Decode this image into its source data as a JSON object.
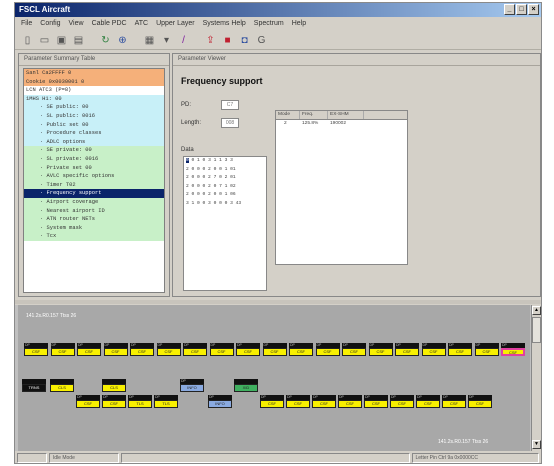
{
  "app": {
    "title": "FSCL Aircraft"
  },
  "menu": [
    "File",
    "Config",
    "View",
    "Cable PDC",
    "ATC",
    "Upper Layer",
    "Systems Help",
    "Spectrum",
    "Help"
  ],
  "toolbar_icons": [
    "new-icon",
    "open-icon",
    "save-icon",
    "print-icon",
    "refresh-icon",
    "zoom-icon",
    "grid-icon",
    "filter-icon",
    "pen-icon",
    "upload-icon",
    "stop-icon",
    "camera-icon",
    "settings-icon"
  ],
  "tree": {
    "header": "Parameter Summary Table",
    "items": [
      {
        "text": "Sanl    Ca2FFFF 0",
        "level": 0,
        "bg": "#f5b07a"
      },
      {
        "text": "Cookie   0x0030001 0",
        "level": 0,
        "bg": "#f5b07a"
      },
      {
        "text": "LCN      ATC3 (P=8)",
        "level": 0,
        "bg": "#ffffff"
      },
      {
        "text": "1MHS     H1: 00",
        "level": 0,
        "bg": "#c8f0f8"
      },
      {
        "text": "SE public: 00",
        "level": 1,
        "bg": "#c8f0f8"
      },
      {
        "text": "SL public: 0016",
        "level": 1,
        "bg": "#c8f0f8"
      },
      {
        "text": "Public set 00",
        "level": 1,
        "bg": "#c8f0f8"
      },
      {
        "text": "Procedure classes",
        "level": 1,
        "bg": "#c8f0f8"
      },
      {
        "text": "ADLC options",
        "level": 1,
        "bg": "#c8f0f8"
      },
      {
        "text": "SE private: 00",
        "level": 1,
        "bg": "#c8f0c8"
      },
      {
        "text": "SL private: 0016",
        "level": 1,
        "bg": "#c8f0c8"
      },
      {
        "text": "Private set 00",
        "level": 1,
        "bg": "#c8f0c8"
      },
      {
        "text": "AVLC specific options",
        "level": 1,
        "bg": "#c8f0c8"
      },
      {
        "text": "Timer T02",
        "level": 1,
        "bg": "#c8f0c8"
      },
      {
        "text": "Frequency support",
        "level": 1,
        "bg": "#0a246a",
        "selected": true
      },
      {
        "text": "Airport coverage",
        "level": 1,
        "bg": "#c8f0c8"
      },
      {
        "text": "Nearest airport ID",
        "level": 1,
        "bg": "#c8f0c8"
      },
      {
        "text": "ATN router NETs",
        "level": 1,
        "bg": "#c8f0c8"
      },
      {
        "text": "System mask",
        "level": 1,
        "bg": "#c8f0c8"
      },
      {
        "text": "Tcx",
        "level": 1,
        "bg": "#c8f0c8"
      }
    ]
  },
  "param": {
    "header": "Parameter Viewer",
    "title": "Frequency support",
    "pd_label": "PD:",
    "pd_value": "C7",
    "length_label": "Length:",
    "length_value": "008",
    "data_label": "Data",
    "data_rows": [
      "0 0 1 0 3 1 1 3 3",
      "2 0 0 0 2 0 0 1 01",
      "2 0 0 0 2 7 0 2 01",
      "2 0 0 0 2 0 7 1 02",
      "2 0 0 0 2 0 0 1 06",
      "3 1 0 0 3 0 0 0 3 43"
    ],
    "data_selected": "0",
    "table_headers": [
      "Mode",
      "Freq.",
      "EX-SHM"
    ],
    "table_rows": [
      [
        "2",
        "125.8%",
        "190002"
      ]
    ]
  },
  "timeline": {
    "info_top": "141.2s.R0.157  Ttss 26",
    "info_bottom": "141.2s.R0.157  Ttss 26",
    "row1": [
      {
        "hd": "DP",
        "label": "CSF",
        "style": ""
      },
      {
        "hd": "DP",
        "label": "CSF",
        "style": ""
      },
      {
        "hd": "DP",
        "label": "CSF",
        "style": ""
      },
      {
        "hd": "DP",
        "label": "CSF",
        "style": ""
      },
      {
        "hd": "DP",
        "label": "CSF",
        "style": ""
      },
      {
        "hd": "DP",
        "label": "CSF",
        "style": ""
      },
      {
        "hd": "DP",
        "label": "CSF",
        "style": ""
      },
      {
        "hd": "DP",
        "label": "CSF",
        "style": ""
      },
      {
        "hd": "DP",
        "label": "CSF",
        "style": ""
      },
      {
        "hd": "DP",
        "label": "CSF",
        "style": ""
      },
      {
        "hd": "DP",
        "label": "CSF",
        "style": ""
      },
      {
        "hd": "DP",
        "label": "CSF",
        "style": ""
      },
      {
        "hd": "DP",
        "label": "CSF",
        "style": ""
      },
      {
        "hd": "DP",
        "label": "CSF",
        "style": ""
      },
      {
        "hd": "DP",
        "label": "CSF",
        "style": ""
      },
      {
        "hd": "DP",
        "label": "CSF",
        "style": ""
      },
      {
        "hd": "DP",
        "label": "CSF",
        "style": ""
      },
      {
        "hd": "DP",
        "label": "CSF",
        "style": ""
      },
      {
        "hd": "DP",
        "label": "CSF",
        "style": "pink"
      }
    ],
    "row2": [
      {
        "hd": "",
        "label": "TRNS",
        "style": "black"
      },
      {
        "hd": "",
        "label": "CLS",
        "style": ""
      },
      {
        "hd": "",
        "label": "CLS",
        "style": ""
      },
      {
        "hd": "DP",
        "label": "INFO",
        "style": "blue"
      },
      {
        "hd": "",
        "label": "XID",
        "style": "green"
      }
    ],
    "row3": [
      {
        "hd": "DP",
        "label": "CSF",
        "style": ""
      },
      {
        "hd": "DP",
        "label": "CSF",
        "style": ""
      },
      {
        "hd": "DP",
        "label": "TLS",
        "style": ""
      },
      {
        "hd": "DP",
        "label": "TLS",
        "style": ""
      },
      {
        "hd": "DP",
        "label": "INFO",
        "style": "blue"
      },
      {
        "hd": "DP",
        "label": "CSF",
        "style": ""
      },
      {
        "hd": "DP",
        "label": "CSF",
        "style": ""
      },
      {
        "hd": "DP",
        "label": "CSF",
        "style": ""
      },
      {
        "hd": "DP",
        "label": "CSF",
        "style": ""
      },
      {
        "hd": "DP",
        "label": "CSF",
        "style": ""
      },
      {
        "hd": "DP",
        "label": "CSF",
        "style": ""
      },
      {
        "hd": "DP",
        "label": "CSF",
        "style": ""
      },
      {
        "hd": "DP",
        "label": "CSF",
        "style": ""
      },
      {
        "hd": "DP",
        "label": "CSF",
        "style": ""
      }
    ]
  },
  "status": {
    "left": "",
    "mid": "Idle Mode",
    "right": "Letter Pin Ctrl 9a 0x0000CC"
  },
  "colors": {
    "selected": "#0a246a",
    "orange": "#f5b07a",
    "cyan": "#c8f0f8",
    "green": "#c8f0c8",
    "block_yellow": "#f8f000"
  }
}
